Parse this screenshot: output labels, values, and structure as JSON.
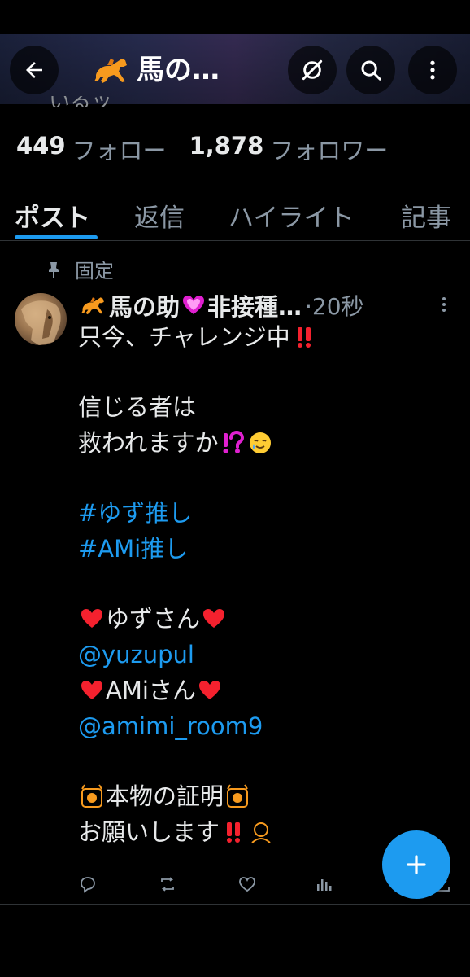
{
  "header": {
    "title": "馬の…",
    "partial_text": "いるッ"
  },
  "profile": {
    "following_count": "449",
    "following_label": "フォロー",
    "followers_count": "1,878",
    "followers_label": "フォロワー"
  },
  "tabs": [
    {
      "label": "ポスト",
      "active": true
    },
    {
      "label": "返信",
      "active": false
    },
    {
      "label": "ハイライト",
      "active": false
    },
    {
      "label": "記事",
      "active": false
    }
  ],
  "post": {
    "pinned_label": "固定",
    "name": "馬の助",
    "name_rest": "非接種…",
    "time": "·20秒",
    "lines": {
      "l1": "只今、チャレンジ中",
      "l2": "信じる者は",
      "l3": "救われますか",
      "l4": "#ゆず推し",
      "l5": "#AMi推し",
      "l6": "ゆずさん",
      "l7": "@yuzupul",
      "l8": "AMiさん",
      "l9": "@amimi_room9",
      "l10": "本物の証明",
      "l11": "お願いします"
    }
  },
  "colors": {
    "accent": "#1d9bf0",
    "background": "#000000",
    "muted": "#8b98a5",
    "red_mark": "#f4212e",
    "heart_pink": "#e020d0"
  },
  "icons": [
    "back-arrow-icon",
    "no-sync-icon",
    "search-icon",
    "more-vertical-icon",
    "horse-racing-icon",
    "pin-icon",
    "reply-icon",
    "repost-icon",
    "like-icon",
    "views-icon",
    "share-icon",
    "plus-icon"
  ]
}
